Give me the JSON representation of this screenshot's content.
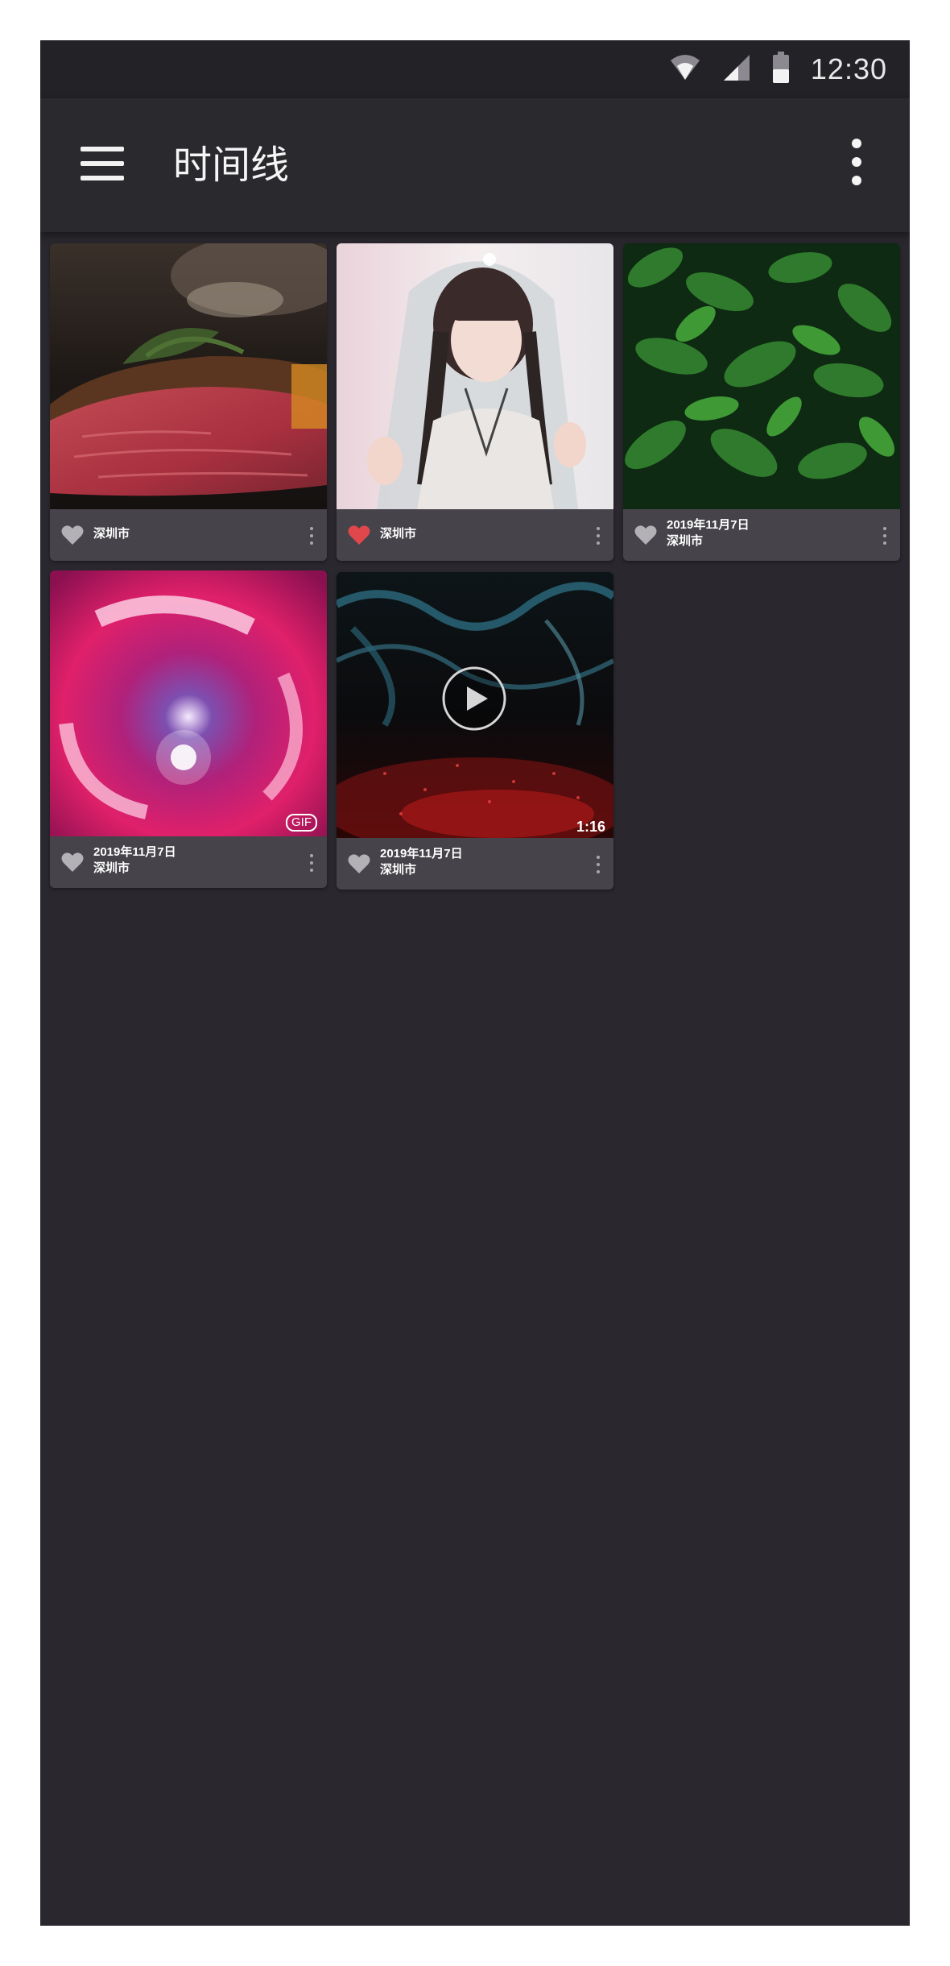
{
  "status_bar": {
    "time": "12:30",
    "icons": [
      "wifi-icon",
      "cell-signal-icon",
      "battery-icon"
    ]
  },
  "app_bar": {
    "title": "时间线",
    "menu_icon": "hamburger-menu-icon",
    "more_icon": "more-vert-icon"
  },
  "colors": {
    "background": "#2a282e",
    "status_bar": "#232227",
    "liked_heart": "#e0474c",
    "unliked_heart": "#b4b1b6"
  },
  "timeline": {
    "items": [
      {
        "subject": "steak",
        "liked": false,
        "date": "",
        "location": "深圳市"
      },
      {
        "subject": "girl-portrait",
        "liked": true,
        "date": "",
        "location": "深圳市"
      },
      {
        "subject": "green-leaves",
        "liked": false,
        "date": "2019年11月7日",
        "location": "深圳市"
      },
      {
        "subject": "pink-vortex",
        "liked": false,
        "date": "2019年11月7日",
        "location": "深圳市",
        "badge": "GIF"
      },
      {
        "subject": "smoke-particles",
        "liked": false,
        "date": "2019年11月7日",
        "location": "深圳市",
        "duration": "1:16"
      }
    ]
  }
}
